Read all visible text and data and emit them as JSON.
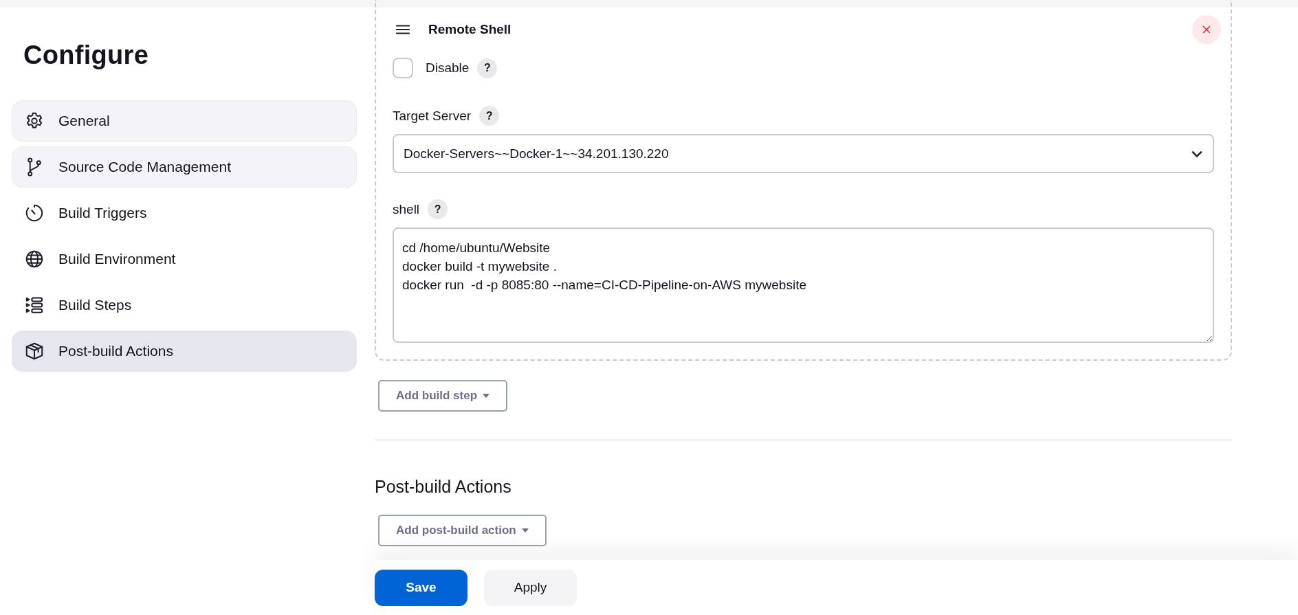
{
  "sidebar": {
    "title": "Configure",
    "items": [
      {
        "label": "General",
        "selected": false,
        "highlighted": true
      },
      {
        "label": "Source Code Management",
        "selected": false,
        "highlighted": true
      },
      {
        "label": "Build Triggers",
        "selected": false,
        "highlighted": false
      },
      {
        "label": "Build Environment",
        "selected": false,
        "highlighted": false
      },
      {
        "label": "Build Steps",
        "selected": false,
        "highlighted": false
      },
      {
        "label": "Post-build Actions",
        "selected": true,
        "highlighted": false
      }
    ]
  },
  "step": {
    "title": "Remote Shell",
    "disable": {
      "label": "Disable",
      "checked": false,
      "help": "?"
    },
    "target_server": {
      "label": "Target Server",
      "help": "?",
      "value": "Docker-Servers~~Docker-1~~34.201.130.220"
    },
    "shell": {
      "label": "shell",
      "help": "?",
      "value": "cd /home/ubuntu/Website\ndocker build -t mywebsite .\ndocker run  -d -p 8085:80 --name=CI-CD-Pipeline-on-AWS mywebsite"
    }
  },
  "add_build_step": "Add build step",
  "post_build": {
    "heading": "Post-build Actions",
    "add_button": "Add post-build action"
  },
  "buttons": [
    {
      "label": "Save",
      "kind": "primary"
    },
    {
      "label": "Apply",
      "kind": "secondary"
    }
  ]
}
